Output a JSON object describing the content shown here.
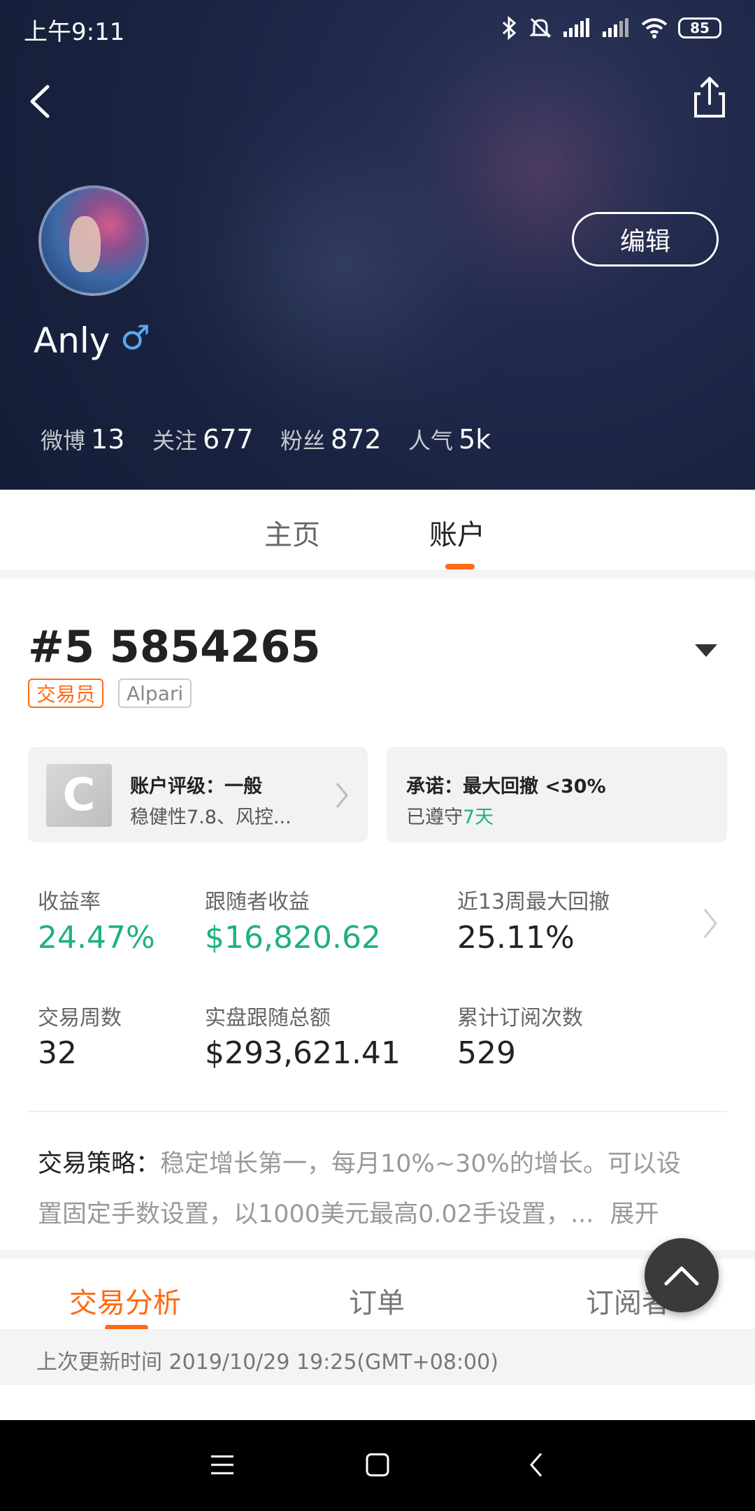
{
  "status_bar": {
    "time": "上午9:11",
    "battery": "85"
  },
  "profile": {
    "name": "Anly",
    "gender_icon": "♂",
    "edit_label": "编辑",
    "stats": [
      {
        "label": "微博",
        "value": "13"
      },
      {
        "label": "关注",
        "value": "677"
      },
      {
        "label": "粉丝",
        "value": "872"
      },
      {
        "label": "人气",
        "value": "5k"
      }
    ]
  },
  "tabs": [
    {
      "label": "主页",
      "active": false
    },
    {
      "label": "账户",
      "active": true
    }
  ],
  "account": {
    "id": "#5 5854265",
    "badges": [
      "交易员",
      "Alpari"
    ],
    "rating": {
      "grade": "C",
      "title": "账户评级：一般",
      "detail": "稳健性7.8、风控..."
    },
    "promise": {
      "title": "承诺：最大回撤 <30%",
      "kept_prefix": "已遵守",
      "kept_days": "7天"
    },
    "metrics": [
      {
        "label": "收益率",
        "value": "24.47%"
      },
      {
        "label": "跟随者收益",
        "value": "$16,820.62"
      },
      {
        "label": "近13周最大回撤",
        "value": "25.11%"
      },
      {
        "label": "交易周数",
        "value": "32"
      },
      {
        "label": "实盘跟随总额",
        "value": "$293,621.41"
      },
      {
        "label": "累计订阅次数",
        "value": "529"
      }
    ],
    "strategy_label": "交易策略：",
    "strategy_text_line1": "稳定增长第一，每月10%~30%的增长。可以设",
    "strategy_text_line2": "置固定手数设置，以1000美元最高0.02手设置，...",
    "expand_label": "展开"
  },
  "bottom_tabs": [
    {
      "label": "交易分析",
      "active": true
    },
    {
      "label": "订单",
      "active": false
    },
    {
      "label": "订阅者",
      "active": false
    }
  ],
  "updated_text": "上次更新时间 2019/10/29 19:25(GMT+08:00)",
  "colors": {
    "accent": "#ff6a13",
    "positive": "#1eb27a"
  }
}
